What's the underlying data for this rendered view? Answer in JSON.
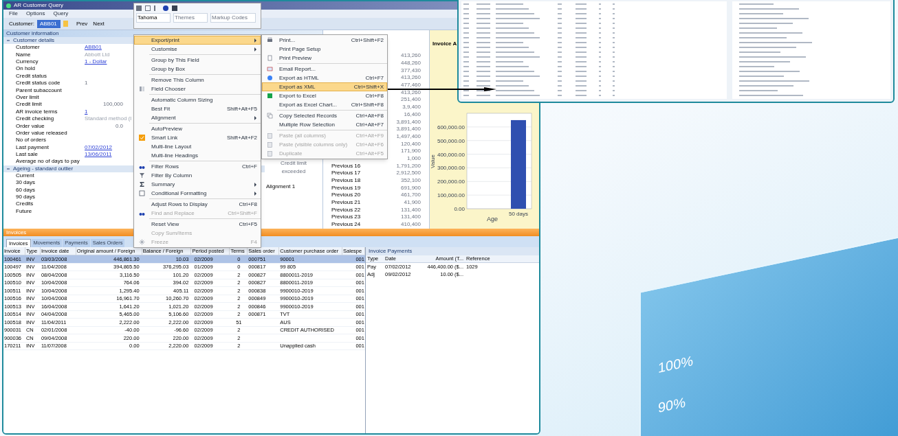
{
  "window": {
    "title": "AR Customer Query"
  },
  "menu_bar": [
    "File",
    "Options",
    "Query"
  ],
  "toolbar": {
    "customer_label": "Customer:",
    "customer_value": "ABB01",
    "prev": "Prev",
    "next": "Next"
  },
  "format_toolbar": {
    "font": "Tahoma",
    "themes": "Themes",
    "markup": "Markup Codes"
  },
  "customer_panel": {
    "title": "Customer information",
    "groups": [
      {
        "title": "Customer details",
        "expanded": true,
        "rows": [
          {
            "label": "Customer",
            "value": "ABB01",
            "kind": "link"
          },
          {
            "label": "Name",
            "value": "Abbott Ltd",
            "kind": "muted"
          },
          {
            "label": "Currency",
            "value": "1 - Dollar",
            "kind": "link"
          },
          {
            "label": "On hold"
          },
          {
            "label": "Credit status"
          },
          {
            "label": "Credit status code",
            "value": "1",
            "kind": "plain"
          },
          {
            "label": "Parent subaccount"
          },
          {
            "label": "Over limit"
          },
          {
            "label": "Credit limit",
            "value": "100,000",
            "kind": "right"
          },
          {
            "label": "AR invoice terms",
            "value": "1",
            "kind": "link"
          },
          {
            "label": "Credit checking",
            "value": "Standard method (l",
            "kind": "muted"
          },
          {
            "label": "Order value",
            "value": "0.0",
            "kind": "right"
          },
          {
            "label": "Order value released"
          },
          {
            "label": "No of orders"
          },
          {
            "label": "Last payment",
            "value": "07/02/2012",
            "kind": "link"
          },
          {
            "label": "Last sale",
            "value": "13/06/2011",
            "kind": "link"
          },
          {
            "label": "Average no of days to pay"
          }
        ]
      },
      {
        "title": "Ageing - standard outlier",
        "expanded": true,
        "rows": [
          {
            "label": "Current"
          },
          {
            "label": "30 days"
          },
          {
            "label": "60 days"
          },
          {
            "label": "90 days"
          },
          {
            "label": "Credits"
          },
          {
            "label": "Future"
          }
        ]
      }
    ]
  },
  "note_text": "Credit limit exceeded",
  "note_label": "Alignment 1",
  "middle_list": [
    {
      "value": "413,260"
    },
    {
      "value": "448,260"
    },
    {
      "value": "377,430"
    },
    {
      "value": "413,260"
    },
    {
      "value": "477,460"
    },
    {
      "value": "413,260"
    },
    {
      "value": "251,400"
    },
    {
      "value": "3,9,400"
    },
    {
      "value": "16,400"
    },
    {
      "value": "3,891,400"
    },
    {
      "value": "3,891,400"
    },
    {
      "value": "1,497,400"
    },
    {
      "value": "120,400"
    },
    {
      "value": "171,900"
    },
    {
      "value": "1,000"
    },
    {
      "label": "Previous 16",
      "value": "1,791,200"
    },
    {
      "label": "Previous 17",
      "value": "2,912,500"
    },
    {
      "label": "Previous 18",
      "value": "352,100"
    },
    {
      "label": "Previous 19",
      "value": "691,900"
    },
    {
      "label": "Previous 20",
      "value": "461,700"
    },
    {
      "label": "Previous 21",
      "value": "41,900"
    },
    {
      "label": "Previous 22",
      "value": "131,400"
    },
    {
      "label": "Previous 23",
      "value": "131,400"
    },
    {
      "label": "Previous 24",
      "value": "410,400"
    }
  ],
  "chart_panel": {
    "title": "Invoice A",
    "chart_data": {
      "type": "bar",
      "xlabel": "Age",
      "ylabel": "Value",
      "categories": [
        "50 days"
      ],
      "values": [
        650000
      ],
      "ylim": [
        0,
        700000
      ],
      "grid": true,
      "yticks": [
        {
          "value": 0,
          "label": "0.00"
        },
        {
          "value": 100000,
          "label": "100,000.00"
        },
        {
          "value": 200000,
          "label": "200,000.00"
        },
        {
          "value": 300000,
          "label": "300,000.00"
        },
        {
          "value": 400000,
          "label": "400,000.00"
        },
        {
          "value": 500000,
          "label": "500,000.00"
        },
        {
          "value": 600000,
          "label": "600,000.00"
        }
      ]
    }
  },
  "invoices_bar": {
    "title": "Invoices"
  },
  "tabs": [
    {
      "label": "Invoices",
      "selected": true
    },
    {
      "label": "Movements",
      "selected": false
    },
    {
      "label": "Payments",
      "selected": false
    },
    {
      "label": "Sales Orders",
      "selected": false
    }
  ],
  "invoice_table": {
    "columns": [
      "Invoice",
      "Type",
      "Invoice date",
      "Original amount / Foreign",
      "Balance / Foreign",
      "Period posted",
      "Terms",
      "Sales order",
      "Customer purchase order",
      "Salespe"
    ],
    "rows": [
      {
        "selected": true,
        "cells": [
          "100461",
          "INV",
          "03/03/2008",
          "446,861.30",
          "10.03",
          "02/2009",
          "0",
          "000751",
          "90001",
          "001"
        ]
      },
      {
        "selected": false,
        "cells": [
          "100497",
          "INV",
          "11/04/2008",
          "394,865.50",
          "376,295.03",
          "01/2009",
          "0",
          "000817",
          "99 805",
          "001"
        ]
      },
      {
        "selected": false,
        "cells": [
          "100505",
          "INV",
          "08/04/2008",
          "3,116.50",
          "101.20",
          "02/2009",
          "2",
          "000827",
          "8800011-2019",
          "001"
        ]
      },
      {
        "selected": false,
        "cells": [
          "100510",
          "INV",
          "10/04/2008",
          "764.06",
          "394.02",
          "02/2009",
          "2",
          "000827",
          "8800011-2019",
          "001"
        ]
      },
      {
        "selected": false,
        "cells": [
          "100511",
          "INV",
          "10/04/2008",
          "1,295.40",
          "405.11",
          "02/2009",
          "2",
          "000838",
          "9900010-2019",
          "001"
        ]
      },
      {
        "selected": false,
        "cells": [
          "100516",
          "INV",
          "10/04/2008",
          "16,961.70",
          "10,260.70",
          "02/2009",
          "2",
          "000849",
          "9900010-2019",
          "001"
        ]
      },
      {
        "selected": false,
        "cells": [
          "100513",
          "INV",
          "16/04/2008",
          "1,641.20",
          "1,021.20",
          "02/2009",
          "2",
          "000846",
          "9900010-2019",
          "001"
        ]
      },
      {
        "selected": false,
        "cells": [
          "100514",
          "INV",
          "04/04/2008",
          "5,465.00",
          "5,106.60",
          "02/2009",
          "2",
          "000871",
          "TVT",
          "001"
        ]
      },
      {
        "selected": false,
        "cells": [
          "100518",
          "INV",
          "11/04/2011",
          "2,222.00",
          "2,222.00",
          "02/2009",
          "51",
          "",
          "AUS",
          "001"
        ]
      },
      {
        "selected": false,
        "cells": [
          "900031",
          "CN",
          "02/01/2008",
          "-40.00",
          "-96.60",
          "02/2009",
          "2",
          "",
          "CREDIT AUTHORISED",
          "001"
        ]
      },
      {
        "selected": false,
        "cells": [
          "900036",
          "CN",
          "09/04/2008",
          "220.00",
          "220.00",
          "02/2009",
          "2",
          "",
          "",
          "001"
        ]
      },
      {
        "selected": false,
        "cells": [
          "170211",
          "INV",
          "11/07/2008",
          "0.00",
          "2,220.00",
          "02/2009",
          "2",
          "",
          "Unapplied cash",
          "001"
        ]
      }
    ]
  },
  "payments_panel": {
    "title": "Invoice Payments",
    "columns": [
      "Type",
      "Date",
      "Amount (T...",
      "Reference"
    ],
    "rows": [
      [
        "Pay",
        "07/02/2012",
        "446,400.00 ($...",
        "1029"
      ],
      [
        "Adj",
        "09/02/2012",
        "10.00 ($..."
      ]
    ]
  },
  "context_menu": {
    "items": [
      {
        "label": "Export/print",
        "submenu": true,
        "selected": true
      },
      {
        "label": "Customise",
        "submenu": true,
        "selected": false
      },
      {
        "label": "Group by This Field",
        "group_start": true,
        "selected": false
      },
      {
        "label": "Group by Box",
        "selected": false
      },
      {
        "label": "Remove This Column",
        "group_start": true,
        "selected": false
      },
      {
        "label": "Field Chooser",
        "kind": "fields",
        "selected": false
      },
      {
        "label": "Automatic Column Sizing",
        "group_start": true,
        "selected": false
      },
      {
        "label": "Best Fit",
        "shortcut": "Shift+Alt+F5",
        "selected": false
      },
      {
        "label": "Alignment",
        "submenu": true,
        "selected": false
      },
      {
        "label": "AutoPreview",
        "group_start": true,
        "selected": false
      },
      {
        "label": "Smart Link",
        "shortcut": "Shift+Alt+F2",
        "checked": true,
        "selected": false
      },
      {
        "label": "Multi-line Layout",
        "selected": false
      },
      {
        "label": "Multi-line Headings",
        "selected": false
      },
      {
        "label": "Filter Rows",
        "shortcut": "Ctrl+F",
        "kind": "binoculars",
        "group_start": true,
        "selected": false
      },
      {
        "label": "Filter By Column",
        "kind": "filter",
        "selected": false
      },
      {
        "label": "Summary",
        "kind": "sum",
        "submenu": true,
        "selected": false
      },
      {
        "label": "Conditional Formatting",
        "kind": "format",
        "submenu": true,
        "selected": false
      },
      {
        "label": "Adjust Rows to Display",
        "shortcut": "Ctrl+F8",
        "group_start": true,
        "selected": false
      },
      {
        "label": "Find and Replace",
        "shortcut": "Ctrl+Shift+F",
        "kind": "binoculars",
        "disabled": true,
        "selected": false
      },
      {
        "label": "Reset View",
        "shortcut": "Ctrl+F5",
        "group_start": true,
        "selected": false
      },
      {
        "label": "Copy Sum/Items",
        "disabled": true,
        "selected": false
      },
      {
        "label": "Freeze",
        "shortcut": "F4",
        "kind": "freeze",
        "disabled": true,
        "selected": false
      }
    ]
  },
  "submenu": {
    "items": [
      {
        "label": "Print...",
        "shortcut": "Ctrl+Shift+F2",
        "kind": "print",
        "selected": false
      },
      {
        "label": "Print Page Setup",
        "selected": false
      },
      {
        "label": "Print Preview",
        "kind": "preview",
        "selected": false
      },
      {
        "label": "Email Report...",
        "kind": "mail",
        "group_start": true,
        "selected": false
      },
      {
        "label": "Export as HTML",
        "shortcut": "Ctrl+F7",
        "kind": "globe",
        "selected": false
      },
      {
        "label": "Export as XML",
        "shortcut": "Ctrl+Shift+X",
        "selected": true
      },
      {
        "label": "Export to Excel",
        "shortcut": "Ctrl+F8",
        "kind": "sheet",
        "selected": false
      },
      {
        "label": "Export as Excel Chart...",
        "shortcut": "Ctrl+Shift+F8",
        "selected": false
      },
      {
        "label": "Copy Selected Records",
        "shortcut": "Ctrl+Alt+F8",
        "kind": "copy",
        "group_start": true,
        "selected": false
      },
      {
        "label": "Multiple Row Selection",
        "shortcut": "Ctrl+Alt+F7",
        "selected": false
      },
      {
        "label": "Paste (all columns)",
        "shortcut": "Ctrl+Alt+F9",
        "kind": "paste",
        "disabled": true,
        "group_start": true,
        "selected": false
      },
      {
        "label": "Paste (visible columns only)",
        "shortcut": "Ctrl+Alt+F6",
        "kind": "paste",
        "disabled": true,
        "selected": false
      },
      {
        "label": "Duplicate",
        "shortcut": "Ctrl+Alt+F5",
        "kind": "paste",
        "disabled": true,
        "selected": false
      }
    ]
  },
  "backdrop": {
    "labels": [
      "100%",
      "90%"
    ]
  }
}
